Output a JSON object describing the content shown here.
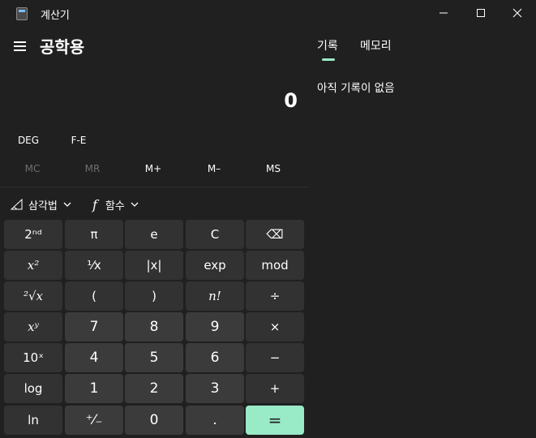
{
  "window": {
    "title": "계산기",
    "icon": "calculator-icon",
    "controls": [
      "minimize-icon",
      "maximize-icon",
      "close-icon"
    ]
  },
  "header": {
    "menu_icon": "hamburger-menu-icon",
    "mode": "공학용"
  },
  "display": {
    "value": "0"
  },
  "mode_buttons": {
    "deg": "DEG",
    "fe": "F-E"
  },
  "memory_buttons": [
    {
      "label": "MC",
      "enabled": false
    },
    {
      "label": "MR",
      "enabled": false
    },
    {
      "label": "M+",
      "enabled": true
    },
    {
      "label": "M–",
      "enabled": true
    },
    {
      "label": "MS",
      "enabled": true
    }
  ],
  "dropdowns": {
    "trig_label": "삼각법",
    "trig_icon": "triangle-icon",
    "func_icon": "function-f-icon",
    "func_label": "함수"
  },
  "keys": [
    [
      "2ⁿᵈ",
      "π",
      "e",
      "C",
      "⌫"
    ],
    [
      "x²",
      "¹⁄x",
      "|x|",
      "exp",
      "mod"
    ],
    [
      "²√x",
      "(",
      ")",
      "n!",
      "÷"
    ],
    [
      "xʸ",
      "7",
      "8",
      "9",
      "×"
    ],
    [
      "10ˣ",
      "4",
      "5",
      "6",
      "−"
    ],
    [
      "log",
      "1",
      "2",
      "3",
      "+"
    ],
    [
      "ln",
      "⁺⁄₋",
      "0",
      ".",
      "="
    ]
  ],
  "panel": {
    "tabs": [
      "기록",
      "메모리"
    ],
    "active_tab": "기록",
    "empty_message": "아직 기록이 없음"
  },
  "colors": {
    "background": "#202020",
    "key_function": "#323232",
    "key_number": "#3b3b3b",
    "accent": "#99ebc7"
  }
}
